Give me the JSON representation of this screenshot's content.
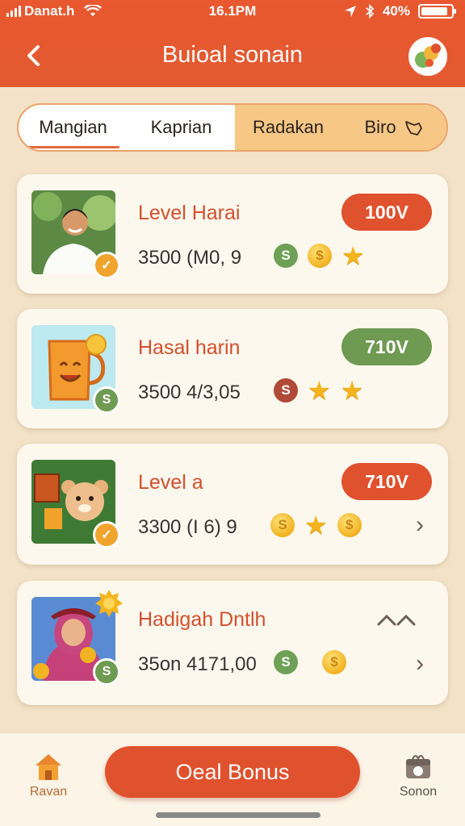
{
  "status_bar": {
    "carrier": "Danat.h",
    "time": "16.1PM",
    "battery": "40%"
  },
  "header": {
    "title": "Buioal sonain"
  },
  "tabs": [
    {
      "label": "Mangian"
    },
    {
      "label": "Kaprian"
    },
    {
      "label": "Radakan"
    },
    {
      "label": "Biro"
    }
  ],
  "cards": [
    {
      "title": "Level Harai",
      "meta": "3500 (M0, 9",
      "pill": "100V",
      "pill_color": "#e0512d"
    },
    {
      "title": "Hasal harin",
      "meta": "3500 4/3,05",
      "pill": "710V",
      "pill_color": "#6f9a52"
    },
    {
      "title": "Level a",
      "meta": "3300 (I 6) 9",
      "pill": "710V",
      "pill_color": "#e0512d"
    },
    {
      "title": "Hadigah Dntlh",
      "meta": "35on 4171,00",
      "pill": ""
    }
  ],
  "bottom": {
    "left_label": "Ravan",
    "cta_label": "Oeal Bonus",
    "right_label": "Sonon"
  },
  "colors": {
    "accent": "#e0512d",
    "green": "#6f9a52",
    "background": "#f3e2c8"
  }
}
